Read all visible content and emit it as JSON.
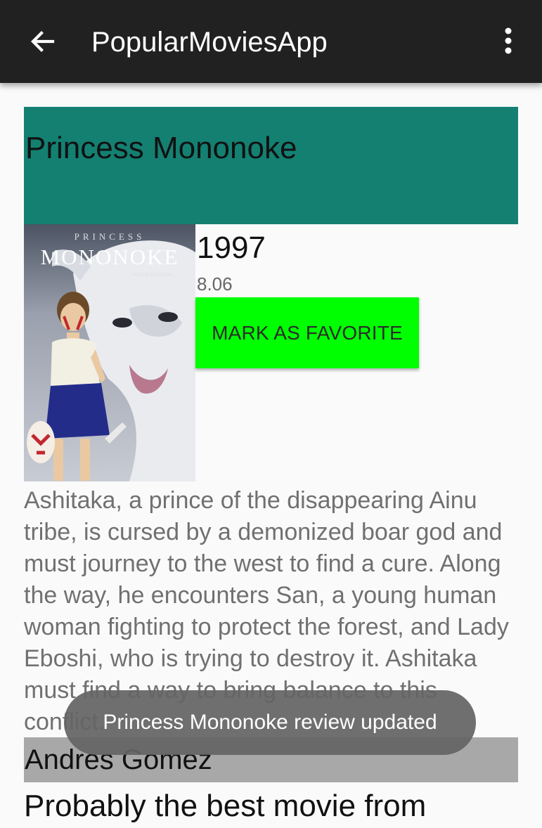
{
  "app_bar": {
    "title": "PopularMoviesApp",
    "back_icon": "arrow-back-icon",
    "menu_icon": "more-vert-icon",
    "background": "#212121"
  },
  "movie": {
    "title": "Princess Mononoke",
    "title_bar_color": "#138072",
    "poster": {
      "brand_top": "PRINCESS",
      "brand_main": "MONONOKE",
      "credit": "HAYAO MIYAZAKI"
    },
    "year": "1997",
    "rating": "8.06",
    "favorite_button_label": "MARK AS FAVORITE",
    "favorite_button_color": "#00ff00",
    "overview": "Ashitaka, a prince of the disappearing Ainu tribe, is cursed by a demonized boar god and must journey to the west to find a cure. Along the way, he encounters San, a young human woman fighting to protect the forest, and Lady Eboshi, who is trying to destroy it. Ashitaka must find a way to bring balance to this conflict."
  },
  "review": {
    "author": "Andres Gomez",
    "content": "Probably the best movie from"
  },
  "toast": {
    "message": "Princess Mononoke review updated"
  }
}
